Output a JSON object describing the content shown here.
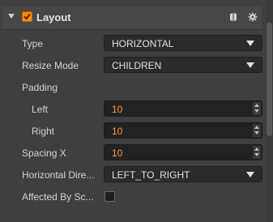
{
  "header": {
    "title": "Layout",
    "enabled": true,
    "icons": [
      "book-icon",
      "gear-icon"
    ],
    "accent_color": "#ff8a00"
  },
  "fields": {
    "type": {
      "label": "Type",
      "value": "HORIZONTAL"
    },
    "resize_mode": {
      "label": "Resize Mode",
      "value": "CHILDREN"
    },
    "padding": {
      "label": "Padding"
    },
    "left": {
      "label": "Left",
      "value": "10"
    },
    "right": {
      "label": "Right",
      "value": "10"
    },
    "spacing_x": {
      "label": "Spacing X",
      "value": "10"
    },
    "horizontal_direction": {
      "label": "Horizontal Dire...",
      "value": "LEFT_TO_RIGHT"
    },
    "affected_by_scale": {
      "label": "Affected By Sc...",
      "checked": false
    }
  }
}
